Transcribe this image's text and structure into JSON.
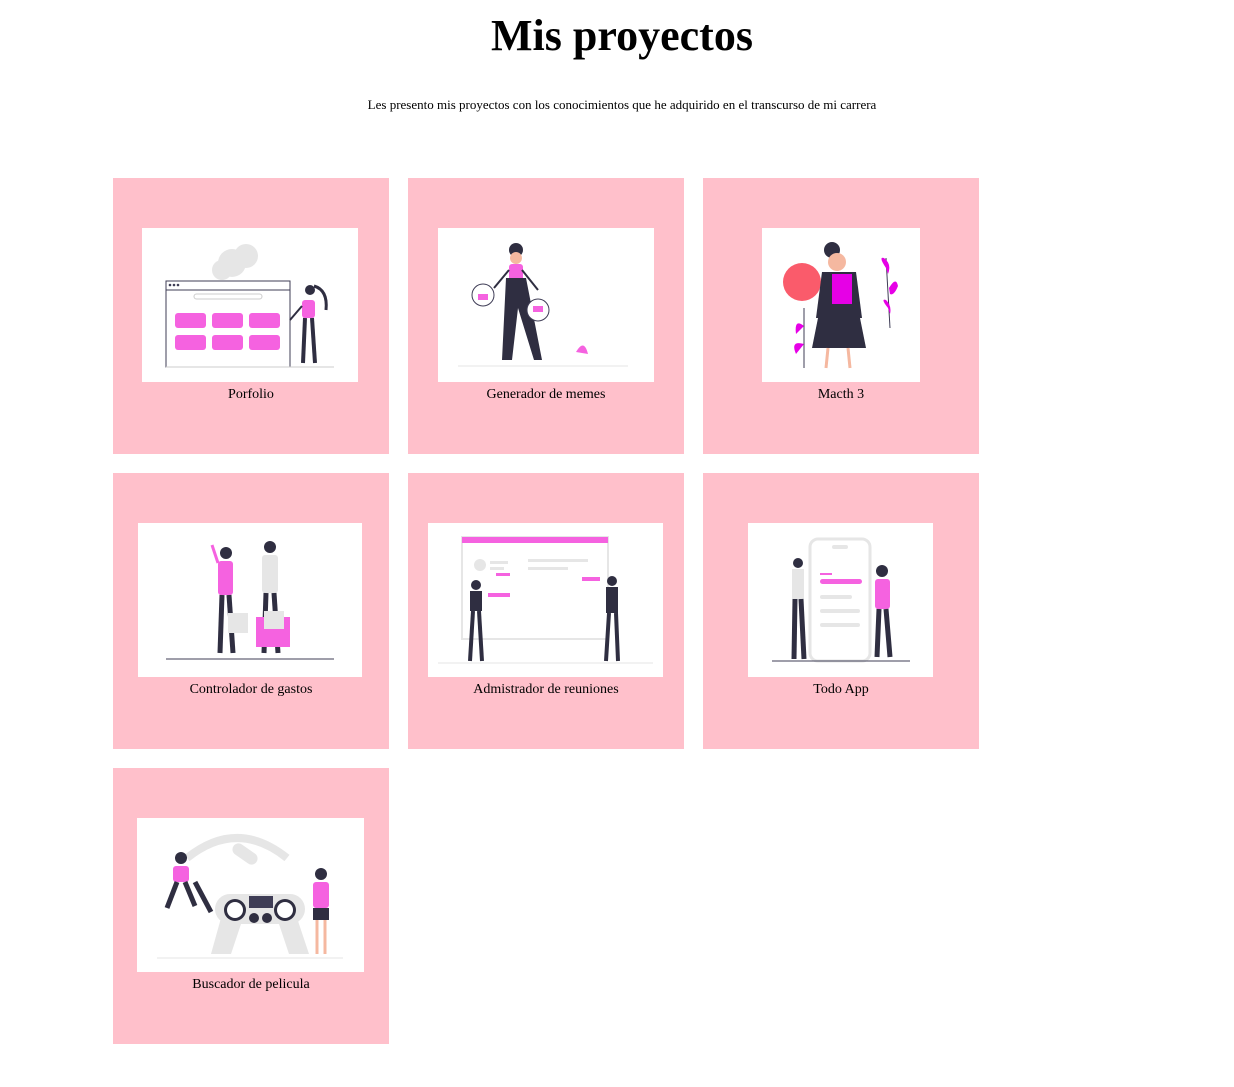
{
  "header": {
    "title": "Mis proyectos",
    "subtitle": "Les presento mis proyectos con los conocimientos que he adquirido en el transcurso de mi carrera"
  },
  "colors": {
    "card_bg": "#ffc0cb",
    "accent": "#f562e0",
    "dark": "#2f2e41",
    "light_gray": "#e6e6e6"
  },
  "projects": [
    {
      "label": "Porfolio",
      "illustration": "website-layout-illustration"
    },
    {
      "label": "Generador de memes",
      "illustration": "likes-dislikes-illustration"
    },
    {
      "label": "Macth 3",
      "illustration": "woman-with-plants-illustration"
    },
    {
      "label": "Controlador de gastos",
      "illustration": "shopping-couple-illustration"
    },
    {
      "label": "Admistrador de reuniones",
      "illustration": "presentation-board-illustration"
    },
    {
      "label": "Todo App",
      "illustration": "mobile-app-illustration"
    },
    {
      "label": "Buscador de pelicula",
      "illustration": "gaming-controller-illustration"
    }
  ]
}
